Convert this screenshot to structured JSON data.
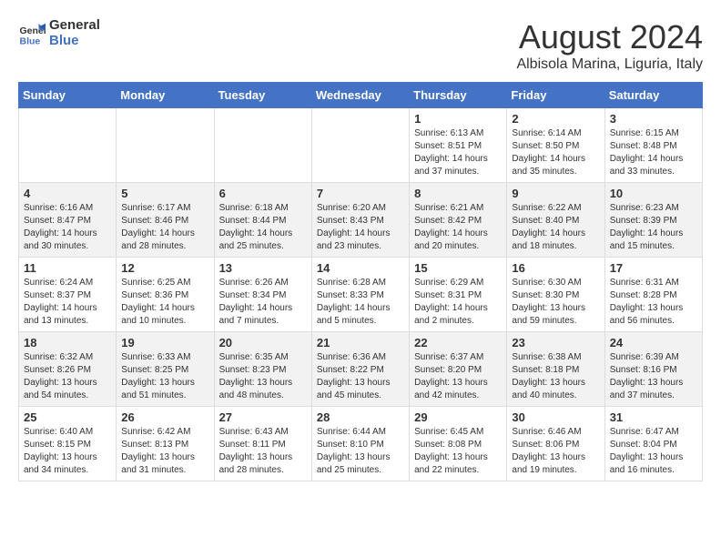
{
  "header": {
    "logo_line1": "General",
    "logo_line2": "Blue",
    "month_year": "August 2024",
    "location": "Albisola Marina, Liguria, Italy"
  },
  "weekdays": [
    "Sunday",
    "Monday",
    "Tuesday",
    "Wednesday",
    "Thursday",
    "Friday",
    "Saturday"
  ],
  "weeks": [
    [
      {
        "day": "",
        "info": ""
      },
      {
        "day": "",
        "info": ""
      },
      {
        "day": "",
        "info": ""
      },
      {
        "day": "",
        "info": ""
      },
      {
        "day": "1",
        "info": "Sunrise: 6:13 AM\nSunset: 8:51 PM\nDaylight: 14 hours and 37 minutes."
      },
      {
        "day": "2",
        "info": "Sunrise: 6:14 AM\nSunset: 8:50 PM\nDaylight: 14 hours and 35 minutes."
      },
      {
        "day": "3",
        "info": "Sunrise: 6:15 AM\nSunset: 8:48 PM\nDaylight: 14 hours and 33 minutes."
      }
    ],
    [
      {
        "day": "4",
        "info": "Sunrise: 6:16 AM\nSunset: 8:47 PM\nDaylight: 14 hours and 30 minutes."
      },
      {
        "day": "5",
        "info": "Sunrise: 6:17 AM\nSunset: 8:46 PM\nDaylight: 14 hours and 28 minutes."
      },
      {
        "day": "6",
        "info": "Sunrise: 6:18 AM\nSunset: 8:44 PM\nDaylight: 14 hours and 25 minutes."
      },
      {
        "day": "7",
        "info": "Sunrise: 6:20 AM\nSunset: 8:43 PM\nDaylight: 14 hours and 23 minutes."
      },
      {
        "day": "8",
        "info": "Sunrise: 6:21 AM\nSunset: 8:42 PM\nDaylight: 14 hours and 20 minutes."
      },
      {
        "day": "9",
        "info": "Sunrise: 6:22 AM\nSunset: 8:40 PM\nDaylight: 14 hours and 18 minutes."
      },
      {
        "day": "10",
        "info": "Sunrise: 6:23 AM\nSunset: 8:39 PM\nDaylight: 14 hours and 15 minutes."
      }
    ],
    [
      {
        "day": "11",
        "info": "Sunrise: 6:24 AM\nSunset: 8:37 PM\nDaylight: 14 hours and 13 minutes."
      },
      {
        "day": "12",
        "info": "Sunrise: 6:25 AM\nSunset: 8:36 PM\nDaylight: 14 hours and 10 minutes."
      },
      {
        "day": "13",
        "info": "Sunrise: 6:26 AM\nSunset: 8:34 PM\nDaylight: 14 hours and 7 minutes."
      },
      {
        "day": "14",
        "info": "Sunrise: 6:28 AM\nSunset: 8:33 PM\nDaylight: 14 hours and 5 minutes."
      },
      {
        "day": "15",
        "info": "Sunrise: 6:29 AM\nSunset: 8:31 PM\nDaylight: 14 hours and 2 minutes."
      },
      {
        "day": "16",
        "info": "Sunrise: 6:30 AM\nSunset: 8:30 PM\nDaylight: 13 hours and 59 minutes."
      },
      {
        "day": "17",
        "info": "Sunrise: 6:31 AM\nSunset: 8:28 PM\nDaylight: 13 hours and 56 minutes."
      }
    ],
    [
      {
        "day": "18",
        "info": "Sunrise: 6:32 AM\nSunset: 8:26 PM\nDaylight: 13 hours and 54 minutes."
      },
      {
        "day": "19",
        "info": "Sunrise: 6:33 AM\nSunset: 8:25 PM\nDaylight: 13 hours and 51 minutes."
      },
      {
        "day": "20",
        "info": "Sunrise: 6:35 AM\nSunset: 8:23 PM\nDaylight: 13 hours and 48 minutes."
      },
      {
        "day": "21",
        "info": "Sunrise: 6:36 AM\nSunset: 8:22 PM\nDaylight: 13 hours and 45 minutes."
      },
      {
        "day": "22",
        "info": "Sunrise: 6:37 AM\nSunset: 8:20 PM\nDaylight: 13 hours and 42 minutes."
      },
      {
        "day": "23",
        "info": "Sunrise: 6:38 AM\nSunset: 8:18 PM\nDaylight: 13 hours and 40 minutes."
      },
      {
        "day": "24",
        "info": "Sunrise: 6:39 AM\nSunset: 8:16 PM\nDaylight: 13 hours and 37 minutes."
      }
    ],
    [
      {
        "day": "25",
        "info": "Sunrise: 6:40 AM\nSunset: 8:15 PM\nDaylight: 13 hours and 34 minutes."
      },
      {
        "day": "26",
        "info": "Sunrise: 6:42 AM\nSunset: 8:13 PM\nDaylight: 13 hours and 31 minutes."
      },
      {
        "day": "27",
        "info": "Sunrise: 6:43 AM\nSunset: 8:11 PM\nDaylight: 13 hours and 28 minutes."
      },
      {
        "day": "28",
        "info": "Sunrise: 6:44 AM\nSunset: 8:10 PM\nDaylight: 13 hours and 25 minutes."
      },
      {
        "day": "29",
        "info": "Sunrise: 6:45 AM\nSunset: 8:08 PM\nDaylight: 13 hours and 22 minutes."
      },
      {
        "day": "30",
        "info": "Sunrise: 6:46 AM\nSunset: 8:06 PM\nDaylight: 13 hours and 19 minutes."
      },
      {
        "day": "31",
        "info": "Sunrise: 6:47 AM\nSunset: 8:04 PM\nDaylight: 13 hours and 16 minutes."
      }
    ]
  ]
}
